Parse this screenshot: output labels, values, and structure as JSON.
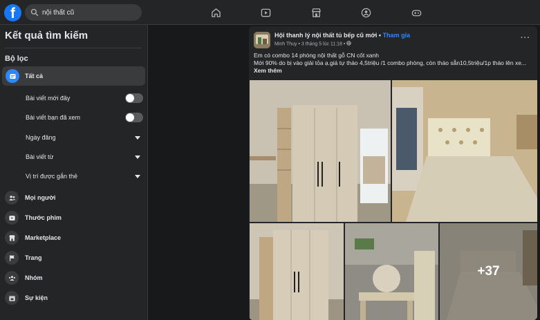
{
  "search": {
    "query": "nội thất cũ"
  },
  "logo": {
    "letter": "f"
  },
  "nav_icons": [
    "home-icon",
    "video-icon",
    "marketplace-icon",
    "groups-icon",
    "gaming-icon"
  ],
  "sidebar": {
    "title": "Kết quả tìm kiếm",
    "filters_label": "Bộ lọc",
    "all_label": "Tất cả",
    "sub_filters": [
      {
        "label": "Bài viết mới đây",
        "control": "toggle"
      },
      {
        "label": "Bài viết bạn đã xem",
        "control": "toggle"
      },
      {
        "label": "Ngày đăng",
        "control": "dropdown"
      },
      {
        "label": "Bài viết từ",
        "control": "dropdown"
      },
      {
        "label": "Vị trí được gắn thẻ",
        "control": "dropdown"
      }
    ],
    "categories": [
      {
        "label": "Mọi người",
        "icon": "people-icon"
      },
      {
        "label": "Thước phim",
        "icon": "reels-icon"
      },
      {
        "label": "Marketplace",
        "icon": "marketplace-icon"
      },
      {
        "label": "Trang",
        "icon": "flag-icon"
      },
      {
        "label": "Nhóm",
        "icon": "groups-icon"
      },
      {
        "label": "Sự kiện",
        "icon": "calendar-icon"
      }
    ]
  },
  "post": {
    "group_name": "Hội thanh lý nội thất tủ bếp cũ mới",
    "separator": " • ",
    "join_label": "Tham gia",
    "author": "Minh Thuy",
    "date": "3 tháng 5 lúc 11:18",
    "more": "···",
    "text_line1": "Em có combo 14 phòng nội thất gỗ CN cốt xanh",
    "text_line2": "Mới 90% do bị vào giải tỏa ạ.giá tự tháo 4,5triệu /1 combo phòng, còn tháo sẵn10,5triệu/1p tháo lên xe...",
    "see_more": "Xem thêm",
    "more_photos": "+37"
  }
}
